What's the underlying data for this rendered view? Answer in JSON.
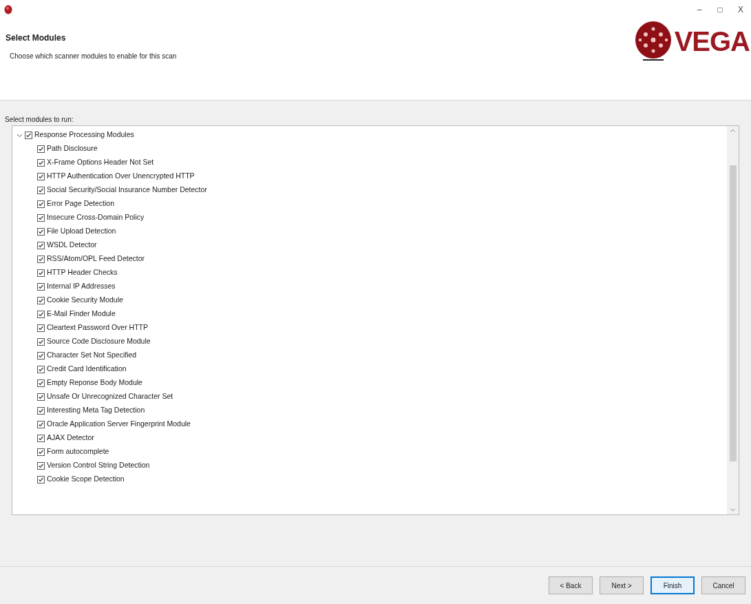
{
  "window": {
    "controls": [
      "–",
      "□",
      "X"
    ]
  },
  "header": {
    "title": "Select Modules",
    "subtitle": "Choose which scanner modules to enable for this scan",
    "logo_text": "VEGA"
  },
  "modules_label": "Select modules to run:",
  "tree": [
    {
      "label": "Response Processing Modules",
      "checked": true,
      "expanded": true,
      "children": [
        {
          "label": "Path Disclosure",
          "checked": true
        },
        {
          "label": "X-Frame Options Header Not Set",
          "checked": true
        },
        {
          "label": "HTTP Authentication Over Unencrypted HTTP",
          "checked": true
        },
        {
          "label": "Social Security/Social Insurance Number Detector",
          "checked": true
        },
        {
          "label": "Error Page Detection",
          "checked": true
        },
        {
          "label": "Insecure Cross-Domain Policy",
          "checked": true
        },
        {
          "label": "File Upload Detection",
          "checked": true
        },
        {
          "label": "WSDL Detector",
          "checked": true
        },
        {
          "label": "RSS/Atom/OPL Feed Detector",
          "checked": true
        },
        {
          "label": "HTTP Header Checks",
          "checked": true
        },
        {
          "label": "Internal IP Addresses",
          "checked": true
        },
        {
          "label": "Cookie Security Module",
          "checked": true
        },
        {
          "label": "E-Mail Finder Module",
          "checked": true
        },
        {
          "label": "Cleartext Password Over HTTP",
          "checked": true
        },
        {
          "label": "Source Code Disclosure Module",
          "checked": true
        },
        {
          "label": "Character Set Not Specified",
          "checked": true
        },
        {
          "label": "Credit Card Identification",
          "checked": true
        },
        {
          "label": "Empty Reponse Body Module",
          "checked": true
        },
        {
          "label": "Unsafe Or Unrecognized Character Set",
          "checked": true
        },
        {
          "label": "Interesting Meta Tag Detection",
          "checked": true
        },
        {
          "label": "Oracle Application Server Fingerprint Module",
          "checked": true
        },
        {
          "label": "AJAX Detector",
          "checked": true
        },
        {
          "label": "Form autocomplete",
          "checked": true
        },
        {
          "label": "Version Control String Detection",
          "checked": true
        },
        {
          "label": "Cookie Scope Detection",
          "checked": true
        }
      ]
    }
  ],
  "buttons": [
    {
      "label": "< Back",
      "default": false
    },
    {
      "label": "Next >",
      "default": false
    },
    {
      "label": "Finish",
      "default": true
    },
    {
      "label": "Cancel",
      "default": false
    }
  ]
}
